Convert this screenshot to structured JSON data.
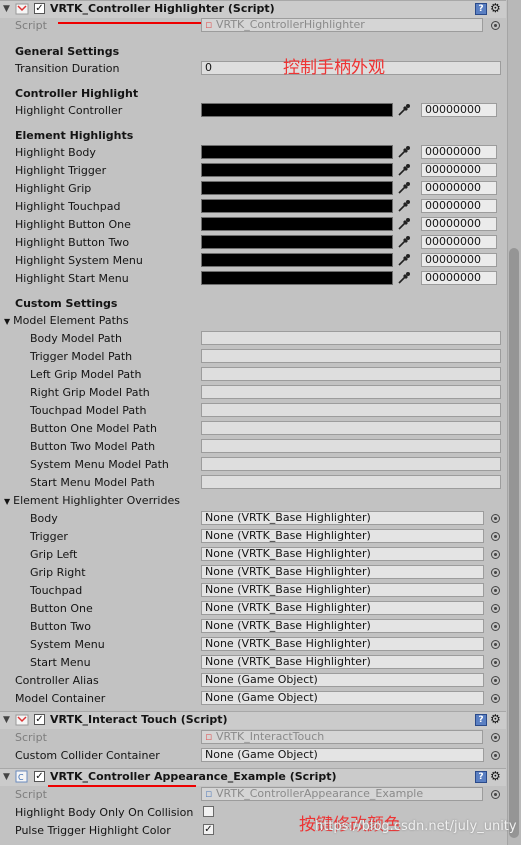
{
  "components": [
    {
      "title": "VRTK_Controller Highlighter (Script)",
      "icon": "c-sharp-script-icon"
    },
    {
      "title": "VRTK_Interact Touch (Script)",
      "icon": "c-sharp-script-icon"
    },
    {
      "title": "VRTK_Controller Appearance_Example (Script)",
      "icon": "c-sharp-file-icon"
    }
  ],
  "highlighter": {
    "script_label": "Script",
    "script_value": "VRTK_ControllerHighlighter",
    "general_settings": "General Settings",
    "transition_duration_label": "Transition Duration",
    "transition_duration_value": "0",
    "controller_highlight": "Controller Highlight",
    "highlight_controller_label": "Highlight Controller",
    "highlight_controller_hex": "00000000",
    "element_highlights": "Element Highlights",
    "elements": [
      {
        "label": "Highlight Body",
        "hex": "00000000"
      },
      {
        "label": "Highlight Trigger",
        "hex": "00000000"
      },
      {
        "label": "Highlight Grip",
        "hex": "00000000"
      },
      {
        "label": "Highlight Touchpad",
        "hex": "00000000"
      },
      {
        "label": "Highlight Button One",
        "hex": "00000000"
      },
      {
        "label": "Highlight Button Two",
        "hex": "00000000"
      },
      {
        "label": "Highlight System Menu",
        "hex": "00000000"
      },
      {
        "label": "Highlight Start Menu",
        "hex": "00000000"
      }
    ],
    "custom_settings": "Custom Settings",
    "model_element_paths": "Model Element Paths",
    "paths": [
      "Body Model Path",
      "Trigger Model Path",
      "Left Grip Model Path",
      "Right Grip Model Path",
      "Touchpad Model Path",
      "Button One Model Path",
      "Button Two Model Path",
      "System Menu Model Path",
      "Start Menu Model Path"
    ],
    "overrides_label": "Element Highlighter Overrides",
    "overrides": [
      {
        "label": "Body",
        "value": "None (VRTK_Base Highlighter)"
      },
      {
        "label": "Trigger",
        "value": "None (VRTK_Base Highlighter)"
      },
      {
        "label": "Grip Left",
        "value": "None (VRTK_Base Highlighter)"
      },
      {
        "label": "Grip Right",
        "value": "None (VRTK_Base Highlighter)"
      },
      {
        "label": "Touchpad",
        "value": "None (VRTK_Base Highlighter)"
      },
      {
        "label": "Button One",
        "value": "None (VRTK_Base Highlighter)"
      },
      {
        "label": "Button Two",
        "value": "None (VRTK_Base Highlighter)"
      },
      {
        "label": "System Menu",
        "value": "None (VRTK_Base Highlighter)"
      },
      {
        "label": "Start Menu",
        "value": "None (VRTK_Base Highlighter)"
      }
    ],
    "controller_alias_label": "Controller Alias",
    "controller_alias_value": "None (Game Object)",
    "model_container_label": "Model Container",
    "model_container_value": "None (Game Object)"
  },
  "interact_touch": {
    "script_label": "Script",
    "script_value": "VRTK_InteractTouch",
    "collider_label": "Custom Collider Container",
    "collider_value": "None (Game Object)"
  },
  "appearance": {
    "script_label": "Script",
    "script_value": "VRTK_ControllerAppearance_Example",
    "body_only_label": "Highlight Body Only On Collision",
    "body_only_checked": false,
    "pulse_label": "Pulse Trigger Highlight Color",
    "pulse_checked": true
  },
  "annotations": {
    "top": "控制手柄外观",
    "bottom": "按键修改颜色",
    "watermark": "https://blog.csdn.net/july_unity"
  },
  "colors": {
    "annotation_red": "#ee2222",
    "inspector_bg": "#c2c2c2"
  }
}
